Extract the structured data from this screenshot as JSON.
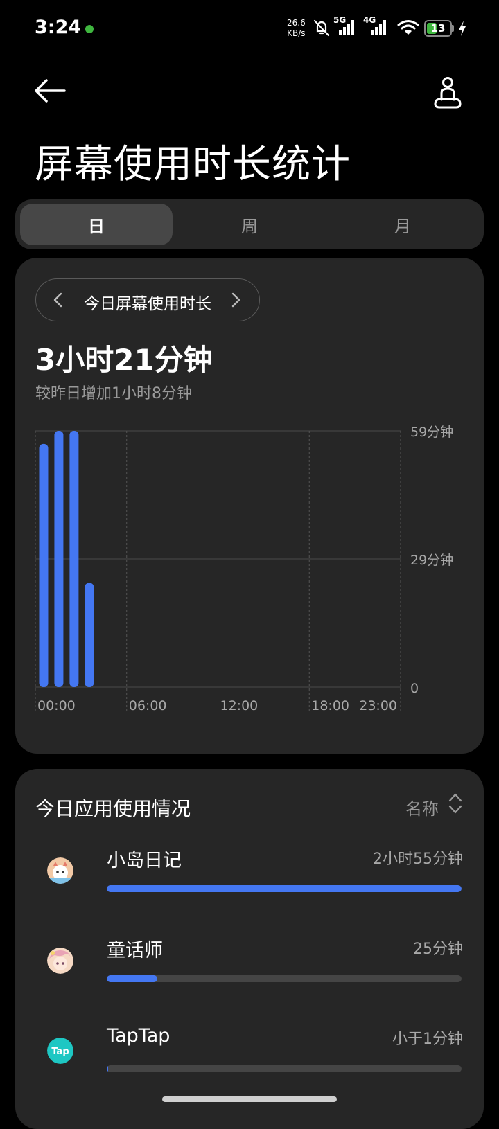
{
  "status_bar": {
    "time": "3:24",
    "net_speed_value": "26.6",
    "net_speed_unit": "KB/s",
    "sim1_label": "5G",
    "sim2_label": "4G",
    "battery_level": "13",
    "icons": [
      "mute-bell-icon",
      "signal-icon",
      "wifi-icon",
      "battery-icon",
      "charging-icon"
    ]
  },
  "header": {
    "back_icon": "back-arrow-icon",
    "meditation_icon": "meditation-icon",
    "title": "屏幕使用时长统计"
  },
  "tabs": [
    {
      "label": "日",
      "active": true
    },
    {
      "label": "周",
      "active": false
    },
    {
      "label": "月",
      "active": false
    }
  ],
  "summary": {
    "period_label": "今日屏幕使用时长",
    "total": "3小时21分钟",
    "comparison": "较昨日增加1小时8分钟"
  },
  "chart_data": {
    "type": "bar",
    "x_tick_labels": [
      "00:00",
      "06:00",
      "12:00",
      "18:00",
      "23:00"
    ],
    "y_tick_labels": [
      "59分钟",
      "29分钟",
      "0"
    ],
    "ylim": [
      0,
      59
    ],
    "bars": [
      {
        "hour": 0,
        "minutes": 56
      },
      {
        "hour": 1,
        "minutes": 59
      },
      {
        "hour": 2,
        "minutes": 59
      },
      {
        "hour": 3,
        "minutes": 24
      }
    ],
    "bar_color": "#4477f2",
    "grid": true
  },
  "app_usage": {
    "title": "今日应用使用情况",
    "sort_label": "名称",
    "apps": [
      {
        "name": "小岛日记",
        "time": "2小时55分钟",
        "fraction": 1.0,
        "icon": "xiaodao-diary-app-icon"
      },
      {
        "name": "童话师",
        "time": "25分钟",
        "fraction": 0.143,
        "icon": "tonghuashi-app-icon"
      },
      {
        "name": "TapTap",
        "time": "小于1分钟",
        "fraction": 0.003,
        "icon": "taptap-app-icon",
        "icon_text": "Tap"
      }
    ]
  },
  "colors": {
    "accent": "#4477f2",
    "card": "#262626",
    "background": "#000000"
  }
}
